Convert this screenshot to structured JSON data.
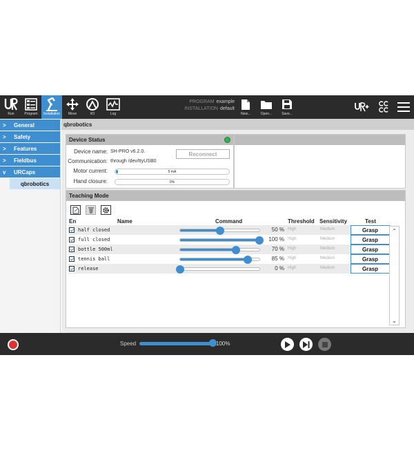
{
  "toolbar": {
    "buttons": [
      {
        "label": "Run",
        "icon": "ur-logo-icon"
      },
      {
        "label": "Program",
        "icon": "program-icon"
      },
      {
        "label": "Installation",
        "icon": "installation-icon"
      },
      {
        "label": "Move",
        "icon": "move-icon"
      },
      {
        "label": "I/O",
        "icon": "io-icon"
      },
      {
        "label": "Log",
        "icon": "log-icon"
      }
    ],
    "program_label": "PROGRAM",
    "program_value": "example",
    "installation_label": "INSTALLATION",
    "installation_value": "default",
    "file_buttons": [
      {
        "label": "New...",
        "icon": "new-file-icon"
      },
      {
        "label": "Open...",
        "icon": "open-folder-icon"
      },
      {
        "label": "Save...",
        "icon": "save-icon"
      }
    ],
    "accent": "#3f8fd0"
  },
  "nav": {
    "items": [
      {
        "label": "General"
      },
      {
        "label": "Safety"
      },
      {
        "label": "Features"
      },
      {
        "label": "Fieldbus"
      },
      {
        "label": "URCaps"
      }
    ],
    "sub_item": "qbrobotics"
  },
  "main": {
    "title": "qbrobotics",
    "device_status": {
      "title": "Device Status",
      "status_color": "#37b24d",
      "device_name_label": "Device name:",
      "device_name": "SH-PRO v6.2.0.",
      "communication_label": "Communication:",
      "communication": "through /dev/ttyUSB0",
      "reconnect_label": "Reconnect",
      "motor_current_label": "Motor current:",
      "motor_current_value": "5 mA",
      "motor_current_fraction": 0.02,
      "hand_closure_label": "Hand closure:",
      "hand_closure_value": "0%",
      "hand_closure_fraction": 0.0
    },
    "teaching": {
      "title": "Teaching Mode",
      "headers": {
        "en": "En",
        "name": "Name",
        "command": "Command",
        "threshold": "Threshold",
        "sensitivity": "Sensitivity",
        "test": "Test"
      },
      "rows": [
        {
          "name": "half closed",
          "percent": 50,
          "percent_text": "50 %",
          "threshold": "High",
          "sensitivity": "Medium",
          "test": "Grasp"
        },
        {
          "name": "full closed",
          "percent": 100,
          "percent_text": "100 %",
          "threshold": "High",
          "sensitivity": "Medium",
          "test": "Grasp"
        },
        {
          "name": "bottle 500ml",
          "percent": 70,
          "percent_text": "70 %",
          "threshold": "High",
          "sensitivity": "Medium",
          "test": "Grasp"
        },
        {
          "name": "tennis ball",
          "percent": 85,
          "percent_text": "85 %",
          "threshold": "High",
          "sensitivity": "Medium",
          "test": "Grasp"
        },
        {
          "name": "release",
          "percent": 0,
          "percent_text": "0 %",
          "threshold": "High",
          "sensitivity": "Medium",
          "test": "Grasp"
        }
      ]
    }
  },
  "bottom": {
    "speed_label": "Speed",
    "speed_value": "100%",
    "speed_fraction": 1.0
  }
}
